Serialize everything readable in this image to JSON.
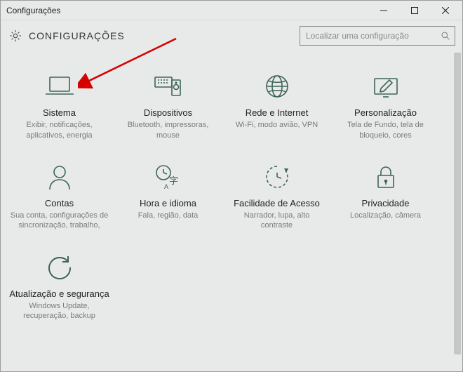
{
  "window": {
    "title": "Configurações"
  },
  "header": {
    "title": "CONFIGURAÇÕES"
  },
  "search": {
    "placeholder": "Localizar uma configuração",
    "value": ""
  },
  "tiles": [
    {
      "id": "sistema",
      "title": "Sistema",
      "desc": "Exibir, notificações, aplicativos, energia"
    },
    {
      "id": "dispositivos",
      "title": "Dispositivos",
      "desc": "Bluetooth, impressoras, mouse"
    },
    {
      "id": "rede",
      "title": "Rede e Internet",
      "desc": "Wi-Fi, modo avião, VPN"
    },
    {
      "id": "personalizacao",
      "title": "Personalização",
      "desc": "Tela de Fundo, tela de bloqueio, cores"
    },
    {
      "id": "contas",
      "title": "Contas",
      "desc": "Sua conta, configurações de sincronização, trabalho,"
    },
    {
      "id": "hora",
      "title": "Hora e idioma",
      "desc": "Fala, região, data"
    },
    {
      "id": "facilidade",
      "title": "Facilidade de Acesso",
      "desc": "Narrador, lupa, alto contraste"
    },
    {
      "id": "privacidade",
      "title": "Privacidade",
      "desc": "Localização, câmera"
    },
    {
      "id": "atualizacao",
      "title": "Atualização e segurança",
      "desc": "Windows Update, recuperação, backup"
    }
  ]
}
